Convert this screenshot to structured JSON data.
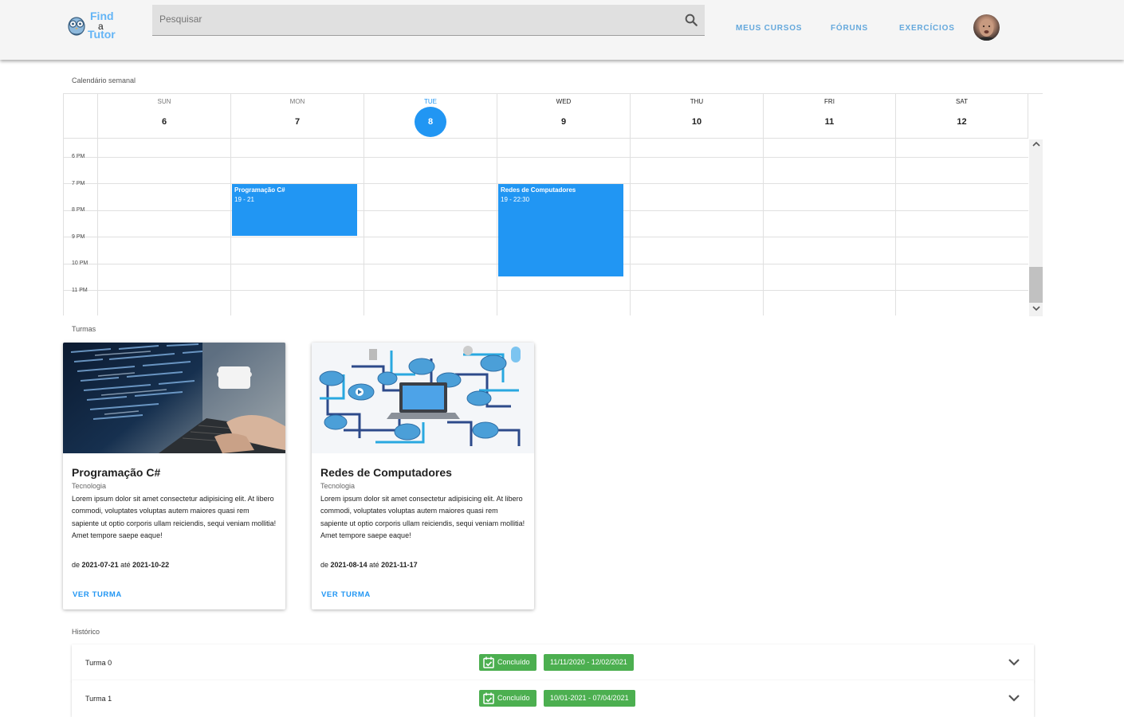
{
  "header": {
    "logo": {
      "find": "Find",
      "a": "a",
      "tutor": "Tutor"
    },
    "search_placeholder": "Pesquisar",
    "nav": [
      "MEUS CURSOS",
      "FÓRUNS",
      "EXERCÍCIOS"
    ]
  },
  "calendar": {
    "label": "Calendário semanal",
    "days": [
      {
        "name": "SUN",
        "num": "6"
      },
      {
        "name": "MON",
        "num": "7"
      },
      {
        "name": "TUE",
        "num": "8",
        "today": true
      },
      {
        "name": "WED",
        "num": "9"
      },
      {
        "name": "THU",
        "num": "10"
      },
      {
        "name": "FRI",
        "num": "11"
      },
      {
        "name": "SAT",
        "num": "12"
      }
    ],
    "hours": [
      "6 PM",
      "7 PM",
      "8 PM",
      "9 PM",
      "10 PM",
      "11 PM"
    ],
    "events": [
      {
        "title": "Programação C#",
        "time": "19 - 21"
      },
      {
        "title": "Redes de Computadores",
        "time": "19 - 22:30"
      }
    ]
  },
  "turmas": {
    "label": "Turmas",
    "cards": [
      {
        "title": "Programação C#",
        "category": "Tecnologia",
        "description": "Lorem ipsum dolor sit amet consectetur adipisicing elit. At libero commodi, voluptates voluptas autem maiores quasi rem sapiente ut optio corporis ullam reiciendis, sequi veniam mollitia! Amet tempore saepe eaque!",
        "de": "de",
        "start": "2021-07-21",
        "ate": "até",
        "end": "2021-10-22",
        "button": "VER TURMA"
      },
      {
        "title": "Redes de Computadores",
        "category": "Tecnologia",
        "description": "Lorem ipsum dolor sit amet consectetur adipisicing elit. At libero commodi, voluptates voluptas autem maiores quasi rem sapiente ut optio corporis ullam reiciendis, sequi veniam mollitia! Amet tempore saepe eaque!",
        "de": "de",
        "start": "2021-08-14",
        "ate": "até",
        "end": "2021-11-17",
        "button": "VER TURMA"
      }
    ]
  },
  "historico": {
    "label": "Histórico",
    "items": [
      {
        "name": "Turma 0",
        "status": "Concluído",
        "dates": "11/11/2020 - 12/02/2021"
      },
      {
        "name": "Turma 1",
        "status": "Concluído",
        "dates": "10/01-2021 - 07/04/2021"
      }
    ]
  },
  "colors": {
    "accent": "#2196f3",
    "success": "#4caf50",
    "nav": "#64a8dc"
  }
}
